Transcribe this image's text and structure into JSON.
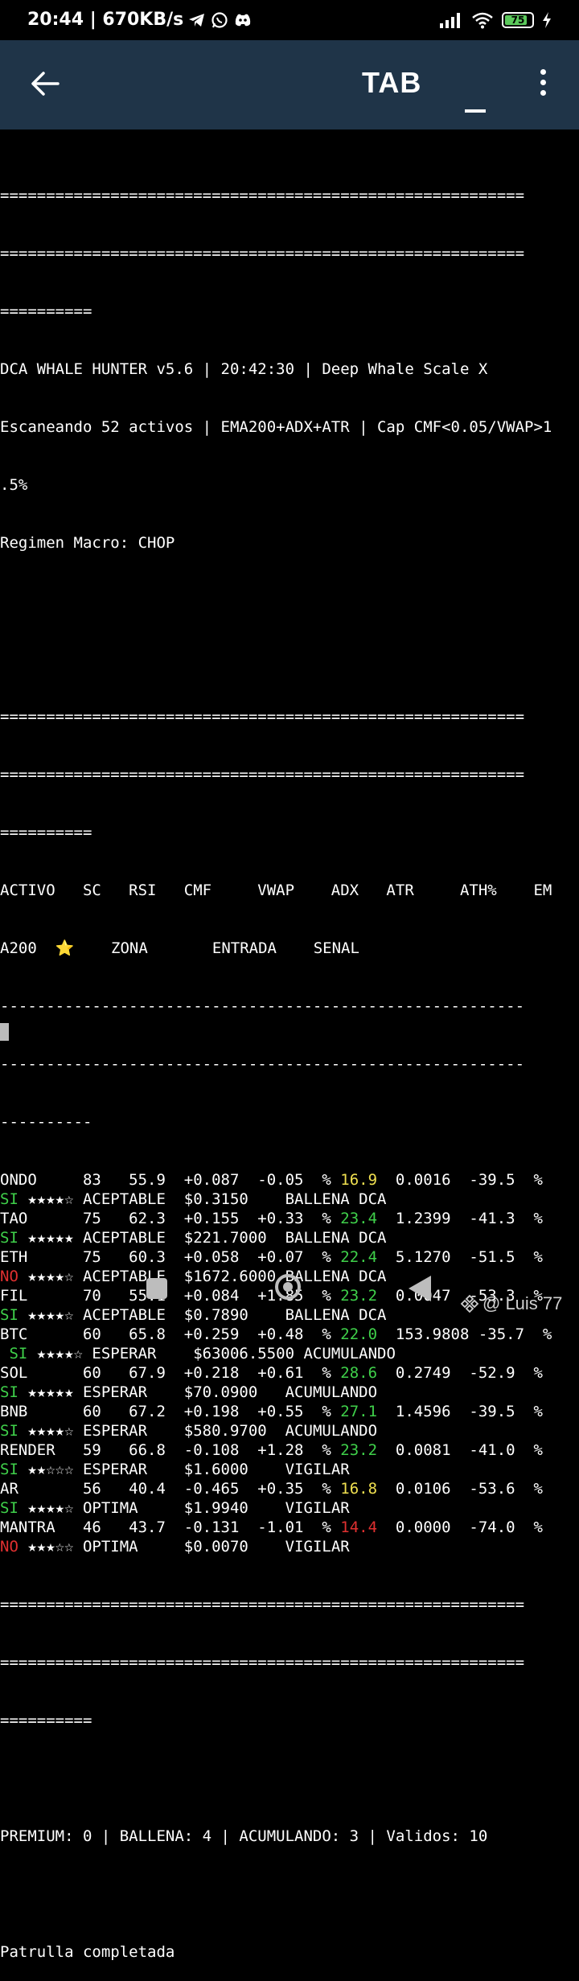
{
  "status_bar": {
    "time_speed": "20:44 | 670KB/s",
    "battery_level": "75",
    "icons": [
      "telegram-icon",
      "whatsapp-icon",
      "discord-icon",
      "signal-icon",
      "wifi-icon",
      "battery-icon",
      "charging-icon"
    ]
  },
  "app_bar": {
    "title": "TAB",
    "back_icon": "arrow-left-icon",
    "minimize_icon": "minimize-icon",
    "menu_icon": "more-vert-icon"
  },
  "terminal": {
    "sep_eq_full": "=========================================================",
    "sep_eq_short": "==========",
    "header_line1": "DCA WHALE HUNTER v5.6 | 20:42:30 | Deep Whale Scale X",
    "header_line2": "Escaneando 52 activos | EMA200+ADX+ATR | Cap CMF<0.05/VWAP>1",
    "header_line3": ".5%",
    "header_line4": "Regimen Macro: CHOP",
    "col_header1": "ACTIVO   SC   RSI   CMF     VWAP    ADX   ATR     ATH%    EM",
    "col_header2": "A200  ⭐    ZONA       ENTRADA    SENAL",
    "sep_dash_full": "---------------------------------------------------------",
    "sep_dash_short": "----------",
    "rows": [
      {
        "a": "ONDO     83   55.9  +0.087  -0.05  % ",
        "adx": "16.9",
        "adx_color": "yellow",
        "b": "  0.0016  -39.5  %",
        "sig": "SI",
        "sig_color": "green",
        "c": " ★★★★☆ ACEPTABLE  $0.3150    BALLENA DCA"
      },
      {
        "a": "TAO      75   62.3  +0.155  +0.33  % ",
        "adx": "23.4",
        "adx_color": "green",
        "b": "  1.2399  -41.3  %",
        "sig": "SI",
        "sig_color": "green",
        "c": " ★★★★★ ACEPTABLE  $221.7000  BALLENA DCA"
      },
      {
        "a": "ETH      75   60.3  +0.058  +0.07  % ",
        "adx": "22.4",
        "adx_color": "green",
        "b": "  5.1270  -51.5  %",
        "sig": "NO",
        "sig_color": "red",
        "c": " ★★★★☆ ACEPTABLE  $1672.6000 BALLENA DCA"
      },
      {
        "a": "FIL      70   55.1  +0.084  +1.85  % ",
        "adx": "23.2",
        "adx_color": "green",
        "b": "  0.0047  -53.3  %",
        "sig": "SI",
        "sig_color": "green",
        "c": " ★★★★☆ ACEPTABLE  $0.7890    BALLENA DCA"
      },
      {
        "a": "BTC      60   65.8  +0.259  +0.48  % ",
        "adx": "22.0",
        "adx_color": "green",
        "b": "  153.9808 -35.7  %",
        "sig": " SI",
        "sig_color": "green",
        "c": " ★★★★☆ ESPERAR    $63006.5500 ACUMULANDO"
      },
      {
        "a": "SOL      60   67.9  +0.218  +0.61  % ",
        "adx": "28.6",
        "adx_color": "green",
        "b": "  0.2749  -52.9  %",
        "sig": "SI",
        "sig_color": "green",
        "c": " ★★★★★ ESPERAR    $70.0900   ACUMULANDO"
      },
      {
        "a": "BNB      60   67.2  +0.198  +0.55  % ",
        "adx": "27.1",
        "adx_color": "green",
        "b": "  1.4596  -39.5  %",
        "sig": "SI",
        "sig_color": "green",
        "c": " ★★★★☆ ESPERAR    $580.9700  ACUMULANDO"
      },
      {
        "a": "RENDER   59   66.8  -0.108  +1.28  % ",
        "adx": "23.2",
        "adx_color": "green",
        "b": "  0.0081  -41.0  %",
        "sig": "SI",
        "sig_color": "green",
        "c": " ★★☆☆☆ ESPERAR    $1.6000    VIGILAR"
      },
      {
        "a": "AR       56   40.4  -0.465  +0.35  % ",
        "adx": "16.8",
        "adx_color": "yellow",
        "b": "  0.0106  -53.6  %",
        "sig": "SI",
        "sig_color": "green",
        "c": " ★★★★☆ OPTIMA     $1.9940    VIGILAR"
      },
      {
        "a": "MANTRA   46   43.7  -0.131  -1.01  % ",
        "adx": "14.4",
        "adx_color": "red",
        "b": "  0.0000  -74.0  %",
        "sig": "NO",
        "sig_color": "red",
        "c": " ★★★☆☆ OPTIMA     $0.0070    VIGILAR"
      }
    ],
    "summary": "PREMIUM: 0 | BALLENA: 4 | ACUMULANDO: 3 | Validos: 10",
    "done": "Patrulla completada"
  },
  "nav_bar": {
    "icons": [
      "recents-square-icon",
      "home-circle-icon",
      "back-triangle-icon"
    ]
  },
  "watermark": {
    "text": "@ Luis 77",
    "icon": "binance-icon"
  }
}
